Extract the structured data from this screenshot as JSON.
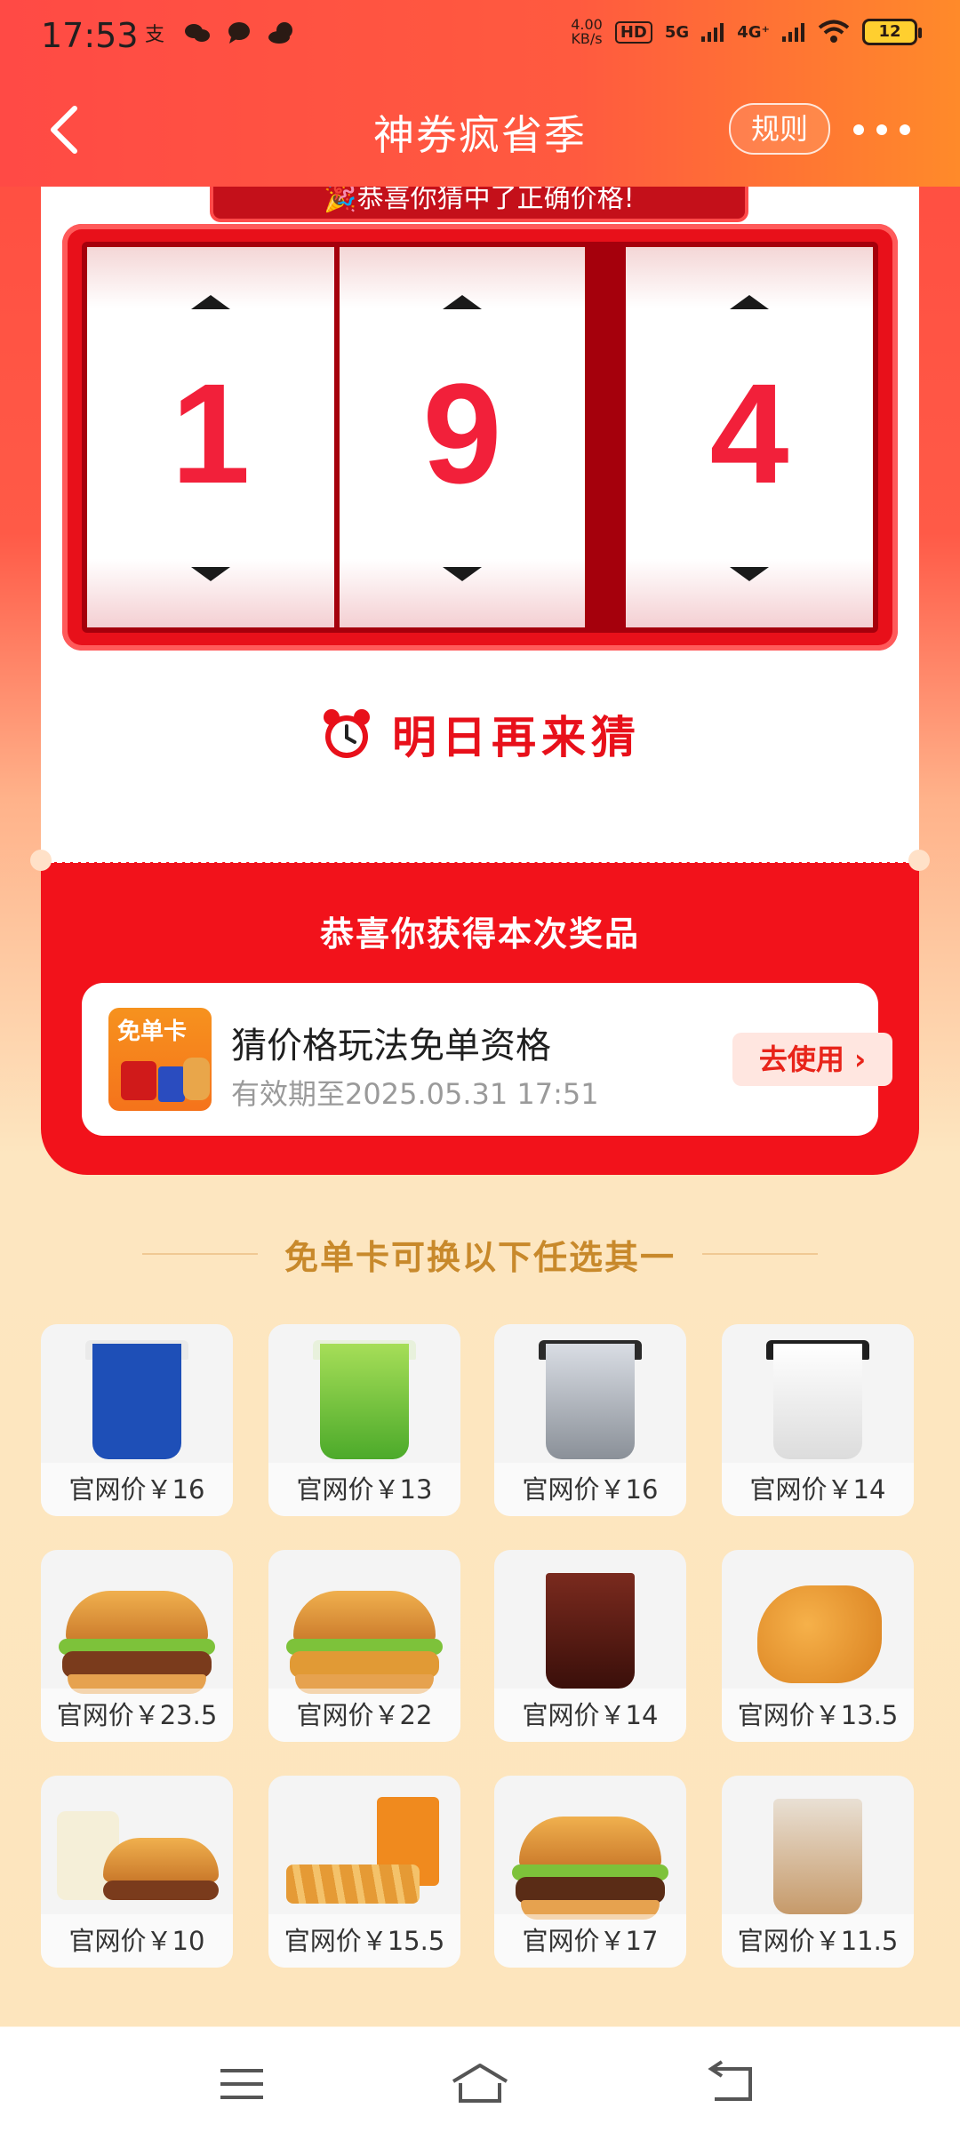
{
  "status_bar": {
    "time": "17:53",
    "net_speed": "4.00",
    "net_speed_unit": "KB/s",
    "hd_label": "HD",
    "signal_1": "5G",
    "signal_2": "4G⁺",
    "battery": "12"
  },
  "nav": {
    "title": "神券疯省季",
    "rules_label": "规则"
  },
  "guess": {
    "banner_text": "🎉恭喜你猜中了正确价格!",
    "digits": [
      "1",
      "9",
      "4"
    ],
    "retry_text": "明日再来猜"
  },
  "prize": {
    "title": "恭喜你获得本次奖品",
    "thumb_badge": "免单卡",
    "name": "猜价格玩法免单资格",
    "expiry": "有效期至2025.05.31 17:51",
    "use_label": "去使用 ›"
  },
  "exchange": {
    "title": "免单卡可换以下任选其一",
    "items": [
      {
        "price": "官网价￥16"
      },
      {
        "price": "官网价￥13"
      },
      {
        "price": "官网价￥16"
      },
      {
        "price": "官网价￥14"
      },
      {
        "price": "官网价￥23.5"
      },
      {
        "price": "官网价￥22"
      },
      {
        "price": "官网价￥14"
      },
      {
        "price": "官网价￥13.5"
      },
      {
        "price": "官网价￥10"
      },
      {
        "price": "官网价￥15.5"
      },
      {
        "price": "官网价￥17"
      },
      {
        "price": "官网价￥11.5"
      }
    ]
  },
  "colors": {
    "accent_red": "#f2121b",
    "digit_red": "#f2203a",
    "gold": "#c8892b",
    "cream": "#fde5bd"
  },
  "icons": [
    "back-icon",
    "more-icon",
    "clock-icon",
    "menu-icon",
    "home-icon",
    "return-icon"
  ]
}
